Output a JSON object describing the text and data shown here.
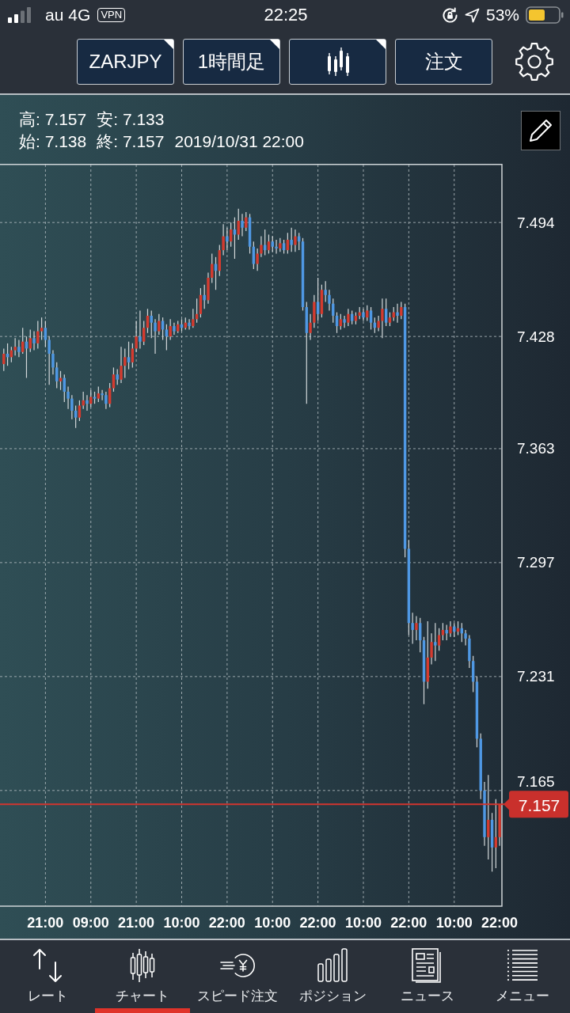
{
  "status_bar": {
    "carrier": "au",
    "network": "4G",
    "vpn": "VPN",
    "time": "22:25",
    "battery": "53%"
  },
  "toolbar": {
    "buttons": [
      {
        "kind": "text",
        "label": "ZARJPY",
        "menu": true
      },
      {
        "kind": "text",
        "label": "1時間足",
        "menu": true
      },
      {
        "kind": "icon",
        "menu": true
      },
      {
        "kind": "text",
        "label": "注文",
        "menu": false
      }
    ]
  },
  "chart": {
    "ohlc": [
      [
        "高: 7.157",
        "安: 7.133"
      ],
      [
        "始: 7.138",
        "終: 7.157",
        "2019/10/31 22:00"
      ]
    ],
    "chart_data": {
      "type": "candlestick",
      "categories": [
        null,
        null,
        null,
        null,
        null,
        null,
        null,
        null,
        null,
        null,
        null,
        "21:00",
        null,
        null,
        null,
        null,
        null,
        null,
        null,
        null,
        null,
        null,
        null,
        "09:00",
        null,
        null,
        null,
        null,
        null,
        null,
        null,
        null,
        null,
        null,
        null,
        "21:00",
        null,
        null,
        null,
        null,
        null,
        null,
        null,
        null,
        null,
        null,
        null,
        "10:00",
        null,
        null,
        null,
        null,
        null,
        null,
        null,
        null,
        null,
        null,
        null,
        "22:00",
        null,
        null,
        null,
        null,
        null,
        null,
        null,
        null,
        null,
        null,
        null,
        "10:00",
        null,
        null,
        null,
        null,
        null,
        null,
        null,
        null,
        null,
        null,
        null,
        "22:00",
        null,
        null,
        null,
        null,
        null,
        null,
        null,
        null,
        null,
        null,
        null,
        "10:00",
        null,
        null,
        null,
        null,
        null,
        null,
        null,
        null,
        null,
        null,
        null,
        "22:00",
        null,
        null,
        null,
        null,
        null,
        null,
        null,
        null,
        null,
        null,
        null,
        "10:00",
        null,
        null,
        null,
        null,
        null,
        null,
        null,
        null,
        null,
        null,
        null,
        "22:00"
      ],
      "ohlc": [
        [
          7.412,
          7.421,
          7.408,
          7.418
        ],
        [
          7.418,
          7.424,
          7.411,
          7.416
        ],
        [
          7.416,
          7.422,
          7.413,
          7.42
        ],
        [
          7.42,
          7.427,
          7.417,
          7.422
        ],
        [
          7.422,
          7.426,
          7.416,
          7.419
        ],
        [
          7.419,
          7.433,
          7.418,
          7.425
        ],
        [
          7.425,
          7.428,
          7.404,
          7.421
        ],
        [
          7.421,
          7.432,
          7.419,
          7.427
        ],
        [
          7.427,
          7.431,
          7.42,
          7.424
        ],
        [
          7.424,
          7.437,
          7.421,
          7.431
        ],
        [
          7.431,
          7.439,
          7.426,
          7.433
        ],
        [
          7.433,
          7.437,
          7.422,
          7.426
        ],
        [
          7.426,
          7.428,
          7.4,
          7.418
        ],
        [
          7.418,
          7.42,
          7.406,
          7.41
        ],
        [
          7.41,
          7.413,
          7.398,
          7.402
        ],
        [
          7.402,
          7.408,
          7.397,
          7.404
        ],
        [
          7.404,
          7.406,
          7.39,
          7.396
        ],
        [
          7.396,
          7.399,
          7.386,
          7.392
        ],
        [
          7.392,
          7.394,
          7.38,
          7.385
        ],
        [
          7.385,
          7.388,
          7.375,
          7.381
        ],
        [
          7.381,
          7.391,
          7.379,
          7.388
        ],
        [
          7.388,
          7.396,
          7.386,
          7.391
        ],
        [
          7.391,
          7.394,
          7.385,
          7.389
        ],
        [
          7.389,
          7.397,
          7.387,
          7.393
        ],
        [
          7.393,
          7.396,
          7.389,
          7.392
        ],
        [
          7.392,
          7.399,
          7.39,
          7.395
        ],
        [
          7.395,
          7.397,
          7.391,
          7.394
        ],
        [
          7.394,
          7.396,
          7.386,
          7.389
        ],
        [
          7.389,
          7.401,
          7.387,
          7.398
        ],
        [
          7.398,
          7.41,
          7.396,
          7.406
        ],
        [
          7.406,
          7.409,
          7.4,
          7.403
        ],
        [
          7.403,
          7.422,
          7.401,
          7.411
        ],
        [
          7.411,
          7.421,
          7.404,
          7.416
        ],
        [
          7.416,
          7.425,
          7.409,
          7.413
        ],
        [
          7.413,
          7.424,
          7.41,
          7.421
        ],
        [
          7.421,
          7.437,
          7.419,
          7.428
        ],
        [
          7.428,
          7.443,
          7.421,
          7.425
        ],
        [
          7.425,
          7.437,
          7.423,
          7.433
        ],
        [
          7.433,
          7.444,
          7.43,
          7.44
        ],
        [
          7.44,
          7.443,
          7.427,
          7.436
        ],
        [
          7.436,
          7.438,
          7.418,
          7.431
        ],
        [
          7.431,
          7.441,
          7.429,
          7.437
        ],
        [
          7.437,
          7.439,
          7.426,
          7.432
        ],
        [
          7.432,
          7.435,
          7.42,
          7.428
        ],
        [
          7.428,
          7.438,
          7.426,
          7.434
        ],
        [
          7.434,
          7.436,
          7.429,
          7.431
        ],
        [
          7.431,
          7.437,
          7.43,
          7.435
        ],
        [
          7.435,
          7.438,
          7.431,
          7.433
        ],
        [
          7.433,
          7.439,
          7.432,
          7.436
        ],
        [
          7.436,
          7.438,
          7.432,
          7.434
        ],
        [
          7.434,
          7.444,
          7.433,
          7.438
        ],
        [
          7.438,
          7.45,
          7.436,
          7.441
        ],
        [
          7.441,
          7.456,
          7.439,
          7.452
        ],
        [
          7.452,
          7.458,
          7.444,
          7.449
        ],
        [
          7.449,
          7.465,
          7.447,
          7.462
        ],
        [
          7.462,
          7.476,
          7.459,
          7.47
        ],
        [
          7.47,
          7.474,
          7.455,
          7.466
        ],
        [
          7.466,
          7.481,
          7.463,
          7.478
        ],
        [
          7.478,
          7.493,
          7.475,
          7.486
        ],
        [
          7.486,
          7.491,
          7.478,
          7.483
        ],
        [
          7.483,
          7.494,
          7.48,
          7.49
        ],
        [
          7.49,
          7.497,
          7.473,
          7.487
        ],
        [
          7.487,
          7.502,
          7.484,
          7.495
        ],
        [
          7.495,
          7.499,
          7.486,
          7.491
        ],
        [
          7.491,
          7.5,
          7.489,
          7.497
        ],
        [
          7.497,
          7.499,
          7.476,
          7.48
        ],
        [
          7.48,
          7.483,
          7.467,
          7.47
        ],
        [
          7.47,
          7.479,
          7.466,
          7.476
        ],
        [
          7.476,
          7.486,
          7.474,
          7.481
        ],
        [
          7.481,
          7.49,
          7.475,
          7.478
        ],
        [
          7.478,
          7.487,
          7.476,
          7.483
        ],
        [
          7.483,
          7.486,
          7.477,
          7.48
        ],
        [
          7.48,
          7.484,
          7.476,
          7.479
        ],
        [
          7.479,
          7.485,
          7.477,
          7.482
        ],
        [
          7.482,
          7.484,
          7.476,
          7.478
        ],
        [
          7.478,
          7.488,
          7.476,
          7.484
        ],
        [
          7.484,
          7.491,
          7.477,
          7.481
        ],
        [
          7.481,
          7.49,
          7.477,
          7.486
        ],
        [
          7.486,
          7.488,
          7.478,
          7.483
        ],
        [
          7.483,
          7.485,
          7.443,
          7.445
        ],
        [
          7.445,
          7.448,
          7.389,
          7.43
        ],
        [
          7.43,
          7.441,
          7.426,
          7.436
        ],
        [
          7.436,
          7.452,
          7.433,
          7.448
        ],
        [
          7.448,
          7.462,
          7.437,
          7.441
        ],
        [
          7.441,
          7.458,
          7.439,
          7.455
        ],
        [
          7.455,
          7.46,
          7.448,
          7.452
        ],
        [
          7.452,
          7.455,
          7.443,
          7.447
        ],
        [
          7.447,
          7.45,
          7.436,
          7.44
        ],
        [
          7.44,
          7.442,
          7.43,
          7.434
        ],
        [
          7.434,
          7.441,
          7.432,
          7.438
        ],
        [
          7.438,
          7.44,
          7.433,
          7.436
        ],
        [
          7.436,
          7.444,
          7.434,
          7.441
        ],
        [
          7.441,
          7.443,
          7.435,
          7.437
        ],
        [
          7.437,
          7.442,
          7.435,
          7.44
        ],
        [
          7.44,
          7.445,
          7.438,
          7.442
        ],
        [
          7.442,
          7.444,
          7.437,
          7.439
        ],
        [
          7.439,
          7.446,
          7.437,
          7.443
        ],
        [
          7.443,
          7.445,
          7.432,
          7.436
        ],
        [
          7.436,
          7.439,
          7.43,
          7.433
        ],
        [
          7.433,
          7.44,
          7.431,
          7.437
        ],
        [
          7.437,
          7.45,
          7.427,
          7.444
        ],
        [
          7.444,
          7.45,
          7.434,
          7.436
        ],
        [
          7.436,
          7.442,
          7.434,
          7.439
        ],
        [
          7.439,
          7.445,
          7.437,
          7.442
        ],
        [
          7.442,
          7.447,
          7.436,
          7.44
        ],
        [
          7.44,
          7.448,
          7.438,
          7.445
        ],
        [
          7.445,
          7.447,
          7.3,
          7.305
        ],
        [
          7.305,
          7.31,
          7.255,
          7.262
        ],
        [
          7.262,
          7.268,
          7.25,
          7.258
        ],
        [
          7.258,
          7.266,
          7.252,
          7.262
        ],
        [
          7.262,
          7.265,
          7.245,
          7.252
        ],
        [
          7.252,
          7.254,
          7.215,
          7.228
        ],
        [
          7.228,
          7.263,
          7.224,
          7.242
        ],
        [
          7.242,
          7.256,
          7.238,
          7.251
        ],
        [
          7.251,
          7.262,
          7.24,
          7.249
        ],
        [
          7.249,
          7.259,
          7.246,
          7.255
        ],
        [
          7.255,
          7.262,
          7.252,
          7.258
        ],
        [
          7.258,
          7.261,
          7.252,
          7.256
        ],
        [
          7.256,
          7.263,
          7.254,
          7.26
        ],
        [
          7.26,
          7.262,
          7.254,
          7.257
        ],
        [
          7.257,
          7.263,
          7.255,
          7.259
        ],
        [
          7.259,
          7.262,
          7.251,
          7.256
        ],
        [
          7.256,
          7.258,
          7.249,
          7.253
        ],
        [
          7.253,
          7.255,
          7.236,
          7.24
        ],
        [
          7.24,
          7.243,
          7.222,
          7.228
        ],
        [
          7.228,
          7.231,
          7.19,
          7.195
        ],
        [
          7.195,
          7.198,
          7.16,
          7.165
        ],
        [
          7.165,
          7.17,
          7.133,
          7.138
        ],
        [
          7.138,
          7.174,
          7.125,
          7.148
        ],
        [
          7.148,
          7.152,
          7.118,
          7.132
        ],
        [
          7.132,
          7.16,
          7.12,
          7.138
        ],
        [
          7.138,
          7.157,
          7.133,
          7.157
        ]
      ],
      "ylim": [
        7.098,
        7.528
      ],
      "yticks": [
        7.494,
        7.428,
        7.363,
        7.297,
        7.231,
        7.165
      ],
      "grid": true,
      "ref_lines": [
        {
          "axis": "y",
          "value": 7.157,
          "label": "7.157",
          "color": "#d2352f"
        }
      ]
    }
  },
  "tabs": [
    {
      "label": "レート",
      "selected": false
    },
    {
      "label": "チャート",
      "selected": true
    },
    {
      "label": "スピード注文",
      "selected": false
    },
    {
      "label": "ポジション",
      "selected": false
    },
    {
      "label": "ニュース",
      "selected": false
    },
    {
      "label": "メニュー",
      "selected": false
    }
  ]
}
